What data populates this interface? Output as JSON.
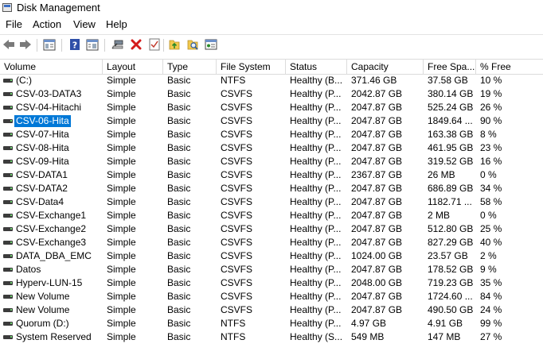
{
  "window": {
    "title": "Disk Management"
  },
  "menu": [
    "File",
    "Action",
    "View",
    "Help"
  ],
  "toolbar": {
    "icons": [
      "back-arrow-icon",
      "forward-arrow-icon",
      "console-tree-icon",
      "help-icon",
      "properties-icon",
      "connect-disk-icon",
      "delete-icon",
      "check-icon",
      "export-icon",
      "search-icon",
      "rescan-icon"
    ]
  },
  "columns": [
    "Volume",
    "Layout",
    "Type",
    "File System",
    "Status",
    "Capacity",
    "Free Spa...",
    "% Free"
  ],
  "selected_row": 3,
  "rows": [
    {
      "volume": " (C:)",
      "layout": "Simple",
      "type": "Basic",
      "fs": "NTFS",
      "status": "Healthy (B...",
      "capacity": "371.46 GB",
      "free": "37.58 GB",
      "pct": "10 %"
    },
    {
      "volume": "CSV-03-DATA3",
      "layout": "Simple",
      "type": "Basic",
      "fs": "CSVFS",
      "status": "Healthy (P...",
      "capacity": "2042.87 GB",
      "free": "380.14 GB",
      "pct": "19 %"
    },
    {
      "volume": "CSV-04-Hitachi",
      "layout": "Simple",
      "type": "Basic",
      "fs": "CSVFS",
      "status": "Healthy (P...",
      "capacity": "2047.87 GB",
      "free": "525.24 GB",
      "pct": "26 %"
    },
    {
      "volume": "CSV-06-Hita",
      "layout": "Simple",
      "type": "Basic",
      "fs": "CSVFS",
      "status": "Healthy (P...",
      "capacity": "2047.87 GB",
      "free": "1849.64 ...",
      "pct": "90 %"
    },
    {
      "volume": "CSV-07-Hita",
      "layout": "Simple",
      "type": "Basic",
      "fs": "CSVFS",
      "status": "Healthy (P...",
      "capacity": "2047.87 GB",
      "free": "163.38 GB",
      "pct": "8 %"
    },
    {
      "volume": "CSV-08-Hita",
      "layout": "Simple",
      "type": "Basic",
      "fs": "CSVFS",
      "status": "Healthy (P...",
      "capacity": "2047.87 GB",
      "free": "461.95 GB",
      "pct": "23 %"
    },
    {
      "volume": "CSV-09-Hita",
      "layout": "Simple",
      "type": "Basic",
      "fs": "CSVFS",
      "status": "Healthy (P...",
      "capacity": "2047.87 GB",
      "free": "319.52 GB",
      "pct": "16 %"
    },
    {
      "volume": "CSV-DATA1",
      "layout": "Simple",
      "type": "Basic",
      "fs": "CSVFS",
      "status": "Healthy (P...",
      "capacity": "2367.87 GB",
      "free": "26 MB",
      "pct": "0 %"
    },
    {
      "volume": "CSV-DATA2",
      "layout": "Simple",
      "type": "Basic",
      "fs": "CSVFS",
      "status": "Healthy (P...",
      "capacity": "2047.87 GB",
      "free": "686.89 GB",
      "pct": "34 %"
    },
    {
      "volume": "CSV-Data4",
      "layout": "Simple",
      "type": "Basic",
      "fs": "CSVFS",
      "status": "Healthy (P...",
      "capacity": "2047.87 GB",
      "free": "1182.71 ...",
      "pct": "58 %"
    },
    {
      "volume": "CSV-Exchange1",
      "layout": "Simple",
      "type": "Basic",
      "fs": "CSVFS",
      "status": "Healthy (P...",
      "capacity": "2047.87 GB",
      "free": "2 MB",
      "pct": "0 %"
    },
    {
      "volume": "CSV-Exchange2",
      "layout": "Simple",
      "type": "Basic",
      "fs": "CSVFS",
      "status": "Healthy (P...",
      "capacity": "2047.87 GB",
      "free": "512.80 GB",
      "pct": "25 %"
    },
    {
      "volume": "CSV-Exchange3",
      "layout": "Simple",
      "type": "Basic",
      "fs": "CSVFS",
      "status": "Healthy (P...",
      "capacity": "2047.87 GB",
      "free": "827.29 GB",
      "pct": "40 %"
    },
    {
      "volume": "DATA_DBA_EMC",
      "layout": "Simple",
      "type": "Basic",
      "fs": "CSVFS",
      "status": "Healthy (P...",
      "capacity": "1024.00 GB",
      "free": "23.57 GB",
      "pct": "2 %"
    },
    {
      "volume": "Datos",
      "layout": "Simple",
      "type": "Basic",
      "fs": "CSVFS",
      "status": "Healthy (P...",
      "capacity": "2047.87 GB",
      "free": "178.52 GB",
      "pct": "9 %"
    },
    {
      "volume": "Hyperv-LUN-15",
      "layout": "Simple",
      "type": "Basic",
      "fs": "CSVFS",
      "status": "Healthy (P...",
      "capacity": "2048.00 GB",
      "free": "719.23 GB",
      "pct": "35 %"
    },
    {
      "volume": "New Volume",
      "layout": "Simple",
      "type": "Basic",
      "fs": "CSVFS",
      "status": "Healthy (P...",
      "capacity": "2047.87 GB",
      "free": "1724.60 ...",
      "pct": "84 %"
    },
    {
      "volume": "New Volume",
      "layout": "Simple",
      "type": "Basic",
      "fs": "CSVFS",
      "status": "Healthy (P...",
      "capacity": "2047.87 GB",
      "free": "490.50 GB",
      "pct": "24 %"
    },
    {
      "volume": "Quorum (D:)",
      "layout": "Simple",
      "type": "Basic",
      "fs": "NTFS",
      "status": "Healthy (P...",
      "capacity": "4.97 GB",
      "free": "4.91 GB",
      "pct": "99 %"
    },
    {
      "volume": "System Reserved",
      "layout": "Simple",
      "type": "Basic",
      "fs": "NTFS",
      "status": "Healthy (S...",
      "capacity": "549 MB",
      "free": "147 MB",
      "pct": "27 %"
    }
  ]
}
